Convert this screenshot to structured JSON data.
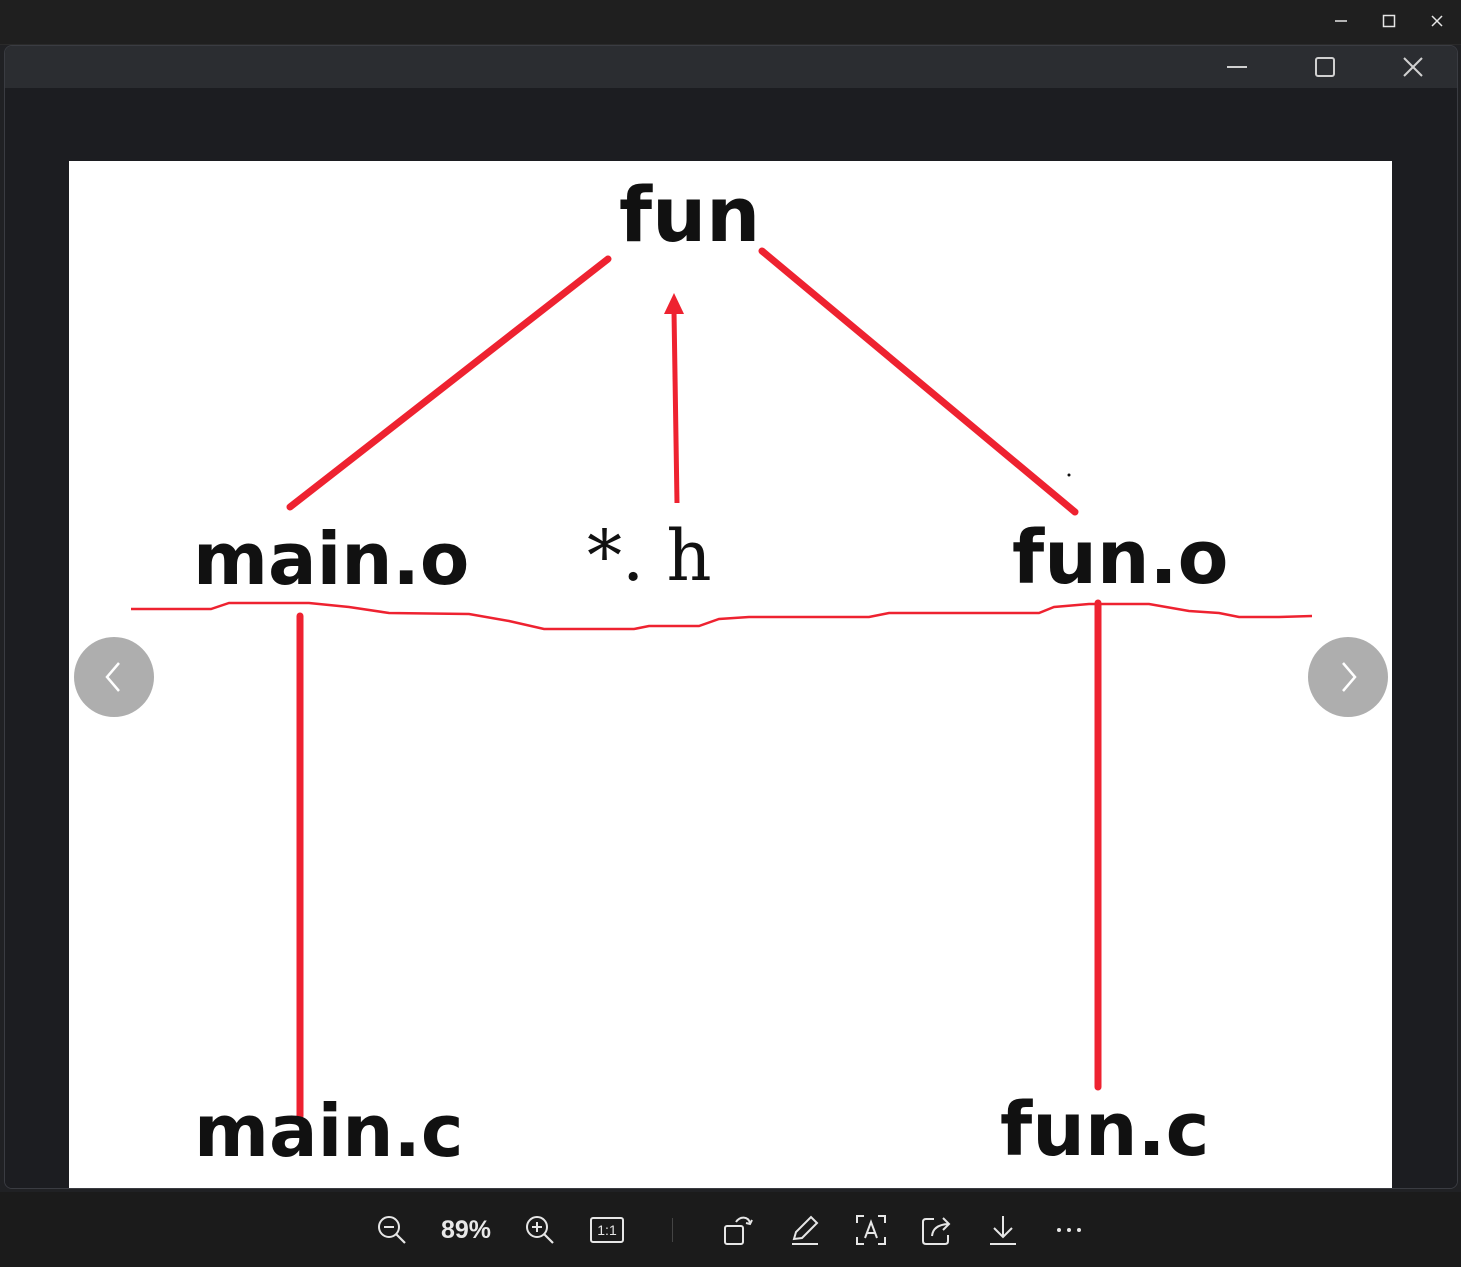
{
  "window": {
    "outer_controls": [
      "minimize-icon",
      "maximize-icon",
      "close-icon"
    ],
    "inner_controls": [
      "minimize-icon",
      "maximize-icon",
      "close-icon"
    ]
  },
  "diagram": {
    "top": "fun",
    "middle_left": "main.o",
    "middle_center": "*. h",
    "middle_right": "fun.o",
    "bottom_left": "main.c",
    "bottom_right": "fun.c",
    "line_color": "#ee2230"
  },
  "navigation": {
    "prev_icon": "chevron-left-icon",
    "next_icon": "chevron-right-icon"
  },
  "toolbar": {
    "zoom_out_icon": "zoom-out-icon",
    "zoom_level": "89%",
    "zoom_in_icon": "zoom-in-icon",
    "actual_size_label": "1:1",
    "rotate_icon": "rotate-icon",
    "edit_icon": "pencil-icon",
    "ocr_icon": "text-recognition-icon",
    "share_icon": "share-icon",
    "download_icon": "download-icon",
    "more_icon": "more-icon"
  }
}
